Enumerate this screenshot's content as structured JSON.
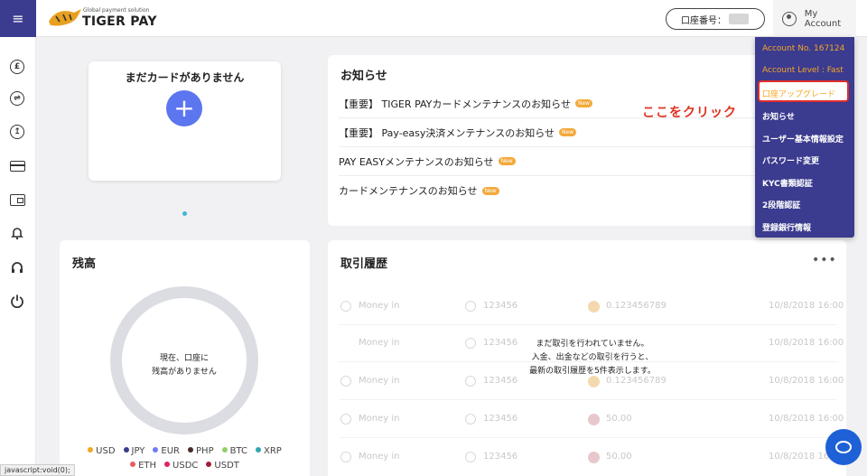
{
  "header": {
    "logo_tag": "Global payment solution",
    "logo_name": "TIGER PAY",
    "account_pill_label": "口座番号：",
    "my_account": "My Account"
  },
  "sidebar": {
    "icons": [
      "currency-icon",
      "exchange-icon",
      "transfer-icon",
      "card-icon",
      "wallet-icon",
      "bell-icon",
      "support-icon",
      "power-icon"
    ]
  },
  "no_card": {
    "title": "まだカードがありません",
    "add_label": "+"
  },
  "notice": {
    "title": "お知らせ",
    "badge": "New",
    "items": [
      "【重要】 TIGER PAYカードメンテナンスのお知らせ",
      "【重要】 Pay-easy決済メンテナンスのお知らせ",
      "PAY EASYメンテナンスのお知らせ",
      "カードメンテナンスのお知らせ"
    ]
  },
  "annotation": {
    "click_here": "ここをクリック"
  },
  "dropdown": {
    "account_no": "Account No. 167124",
    "account_level": "Account Level : Fast",
    "items": [
      "口座アップグレード",
      "お知らせ",
      "ユーザー基本情報設定",
      "パスワード変更",
      "KYC書類認証",
      "2段階認証",
      "登録銀行情報"
    ]
  },
  "balance": {
    "title": "残高",
    "donut_line1": "現在、口座に",
    "donut_line2": "残高がありません",
    "legend_row1": [
      {
        "label": "USD",
        "color": "#f5a623"
      },
      {
        "label": "JPY",
        "color": "#3b3b8f"
      },
      {
        "label": "EUR",
        "color": "#6f7df0"
      },
      {
        "label": "PHP",
        "color": "#4a2a2a"
      },
      {
        "label": "BTC",
        "color": "#8fd06a"
      },
      {
        "label": "XRP",
        "color": "#2fa8b0"
      }
    ],
    "legend_row2": [
      {
        "label": "ETH",
        "color": "#e06060"
      },
      {
        "label": "USDC",
        "color": "#e0206a"
      },
      {
        "label": "USDT",
        "color": "#a0203a"
      }
    ]
  },
  "history": {
    "title": "取引履歴",
    "more": "•••",
    "rows": [
      {
        "type": "Money in",
        "id": "123456",
        "amount": "0.123456789",
        "date": "10/8/2018 16:00"
      },
      {
        "type": "Money in",
        "id": "123456",
        "amount": "",
        "date": "10/8/2018 16:00"
      },
      {
        "type": "Money in",
        "id": "123456",
        "amount": "0.123456789",
        "date": "10/8/2018 16:00"
      },
      {
        "type": "Money in",
        "id": "123456",
        "amount": "50.00",
        "date": "10/8/2018 16:00"
      },
      {
        "type": "Money in",
        "id": "123456",
        "amount": "50.00",
        "date": "10/8/2018 16:00"
      }
    ],
    "empty_line1": "まだ取引を行われていません。",
    "empty_line2": "入金、出金などの取引を行うと、",
    "empty_line3": "最新の取引履歴を5件表示します。"
  },
  "status_bar": "javascript:void(0);"
}
